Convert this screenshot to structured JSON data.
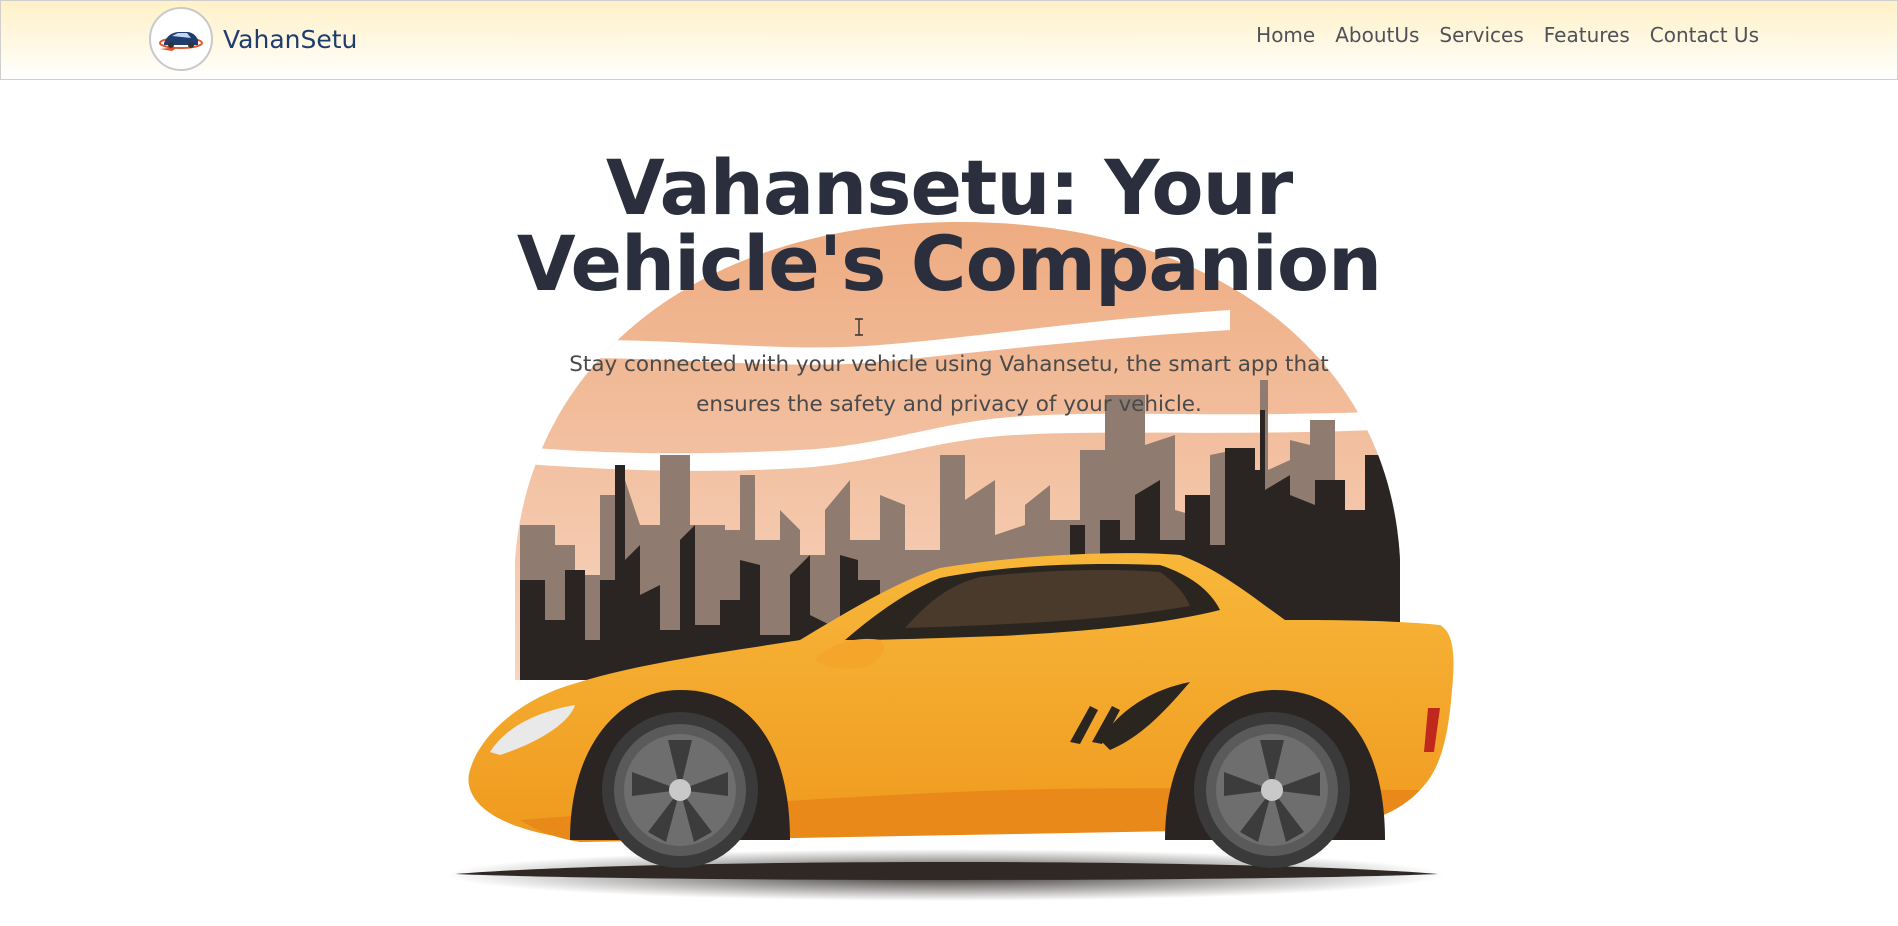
{
  "brand": {
    "name": "VahanSetu",
    "logo_icon": "car-logo-icon"
  },
  "nav": {
    "items": [
      {
        "label": "Home"
      },
      {
        "label": "AboutUs"
      },
      {
        "label": "Services"
      },
      {
        "label": "Features"
      },
      {
        "label": "Contact Us"
      }
    ]
  },
  "hero": {
    "title_line1": "Vahansetu: Your",
    "title_line2": "Vehicle's Companion",
    "subtitle_line1": "Stay connected with your vehicle using Vahansetu, the smart app that",
    "subtitle_line2": "ensures the safety and privacy of your vehicle.",
    "illustration_icon": "sports-car-city-illustration"
  },
  "colors": {
    "navbar_bg": "#fff1c7",
    "brand_text": "#1f3d6e",
    "title_text": "#2b2f3d",
    "sky_peach": "#efb58f",
    "car_yellow": "#f6ae2d",
    "building_dark": "#2a2522"
  }
}
